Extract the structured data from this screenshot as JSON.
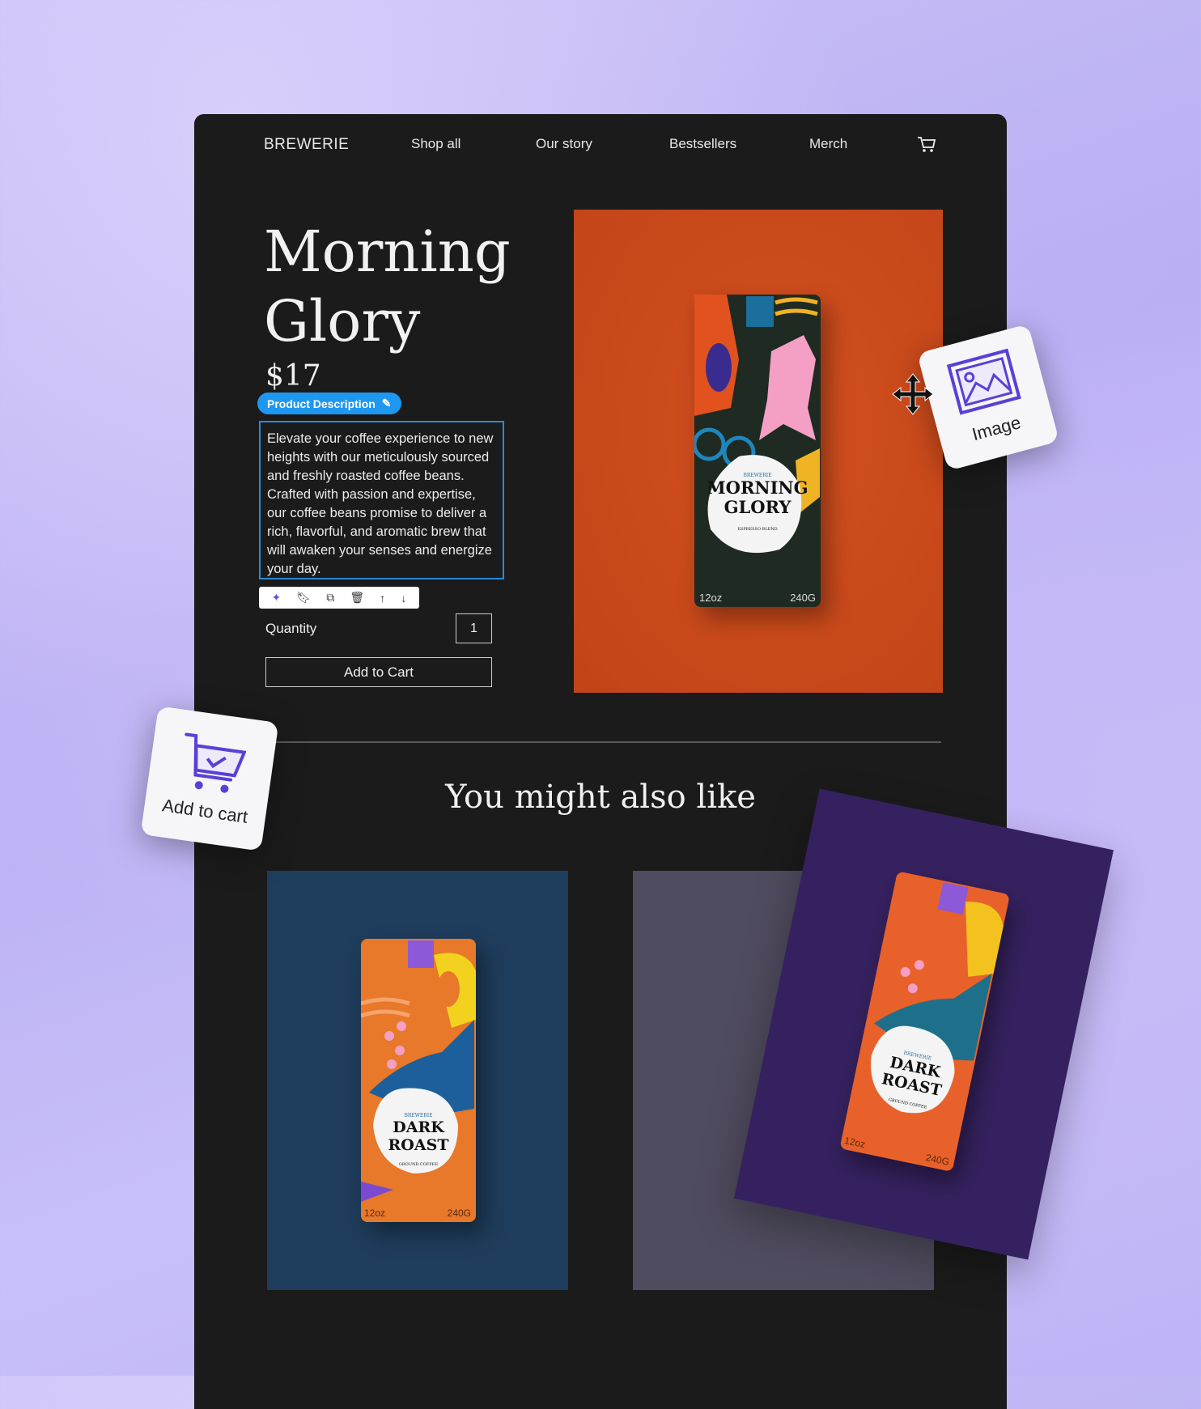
{
  "nav": {
    "brand": "BREWERIE",
    "items": [
      "Shop all",
      "Our story",
      "Bestsellers",
      "Merch"
    ],
    "cart_icon": "cart-icon"
  },
  "product": {
    "title_line1": "Morning",
    "title_line2": "Glory",
    "price": "$17",
    "badge": "Product Description",
    "description": "Elevate your coffee experience to new heights with our meticulously sourced and freshly roasted coffee beans. Crafted with passion and expertise, our coffee beans promise to deliver a rich, flavorful, and aromatic brew that will awaken your senses and energize your day.",
    "toolbar_icons": [
      "sparkle-icon",
      "bookmark-icon",
      "duplicate-icon",
      "trash-icon",
      "arrow-up-icon",
      "arrow-down-icon"
    ],
    "quantity_label": "Quantity",
    "quantity_value": "1",
    "add_to_cart": "Add to Cart"
  },
  "bags": {
    "morning": {
      "brand": "BREWERIE",
      "name1": "MORNING",
      "name2": "GLORY",
      "sub": "ESPRESSO BLEND",
      "size_left": "12oz",
      "size_right": "240G"
    },
    "dark": {
      "brand": "BREWERIE",
      "name1": "DARK",
      "name2": "ROAST",
      "sub": "GROUND COFFEE",
      "size_left": "12oz",
      "size_right": "240G"
    }
  },
  "related": {
    "heading": "You might also like"
  },
  "widgets": {
    "image": "Image",
    "add_to_cart": "Add to cart"
  },
  "colors": {
    "panel": "#1b1b1c",
    "hero": "#c9481b",
    "accent": "#1e97f0",
    "widget_icon": "#5b3fd6",
    "card1": "#1f3d5c",
    "card2": "#504c5f",
    "dragged_card": "#35215f"
  }
}
